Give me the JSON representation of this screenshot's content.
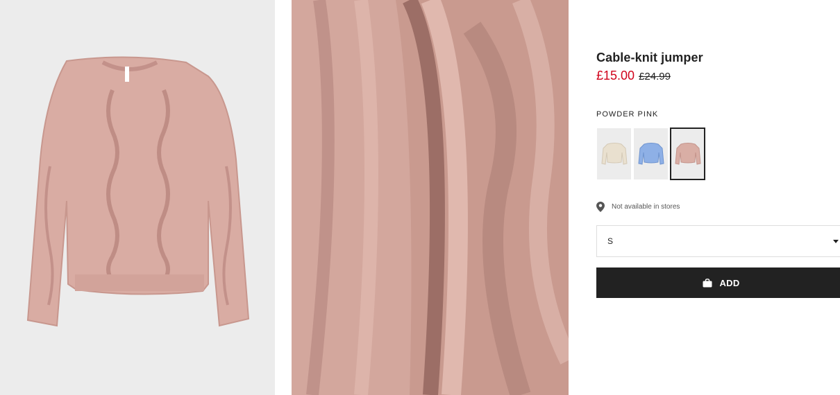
{
  "product": {
    "title": "Cable-knit jumper",
    "price_sale": "£15.00",
    "price_original": "£24.99"
  },
  "colors": {
    "selected_name": "POWDER PINK",
    "swatches": [
      {
        "icon": "sweater-beige-thumbnail",
        "hex": "#e9e0cf"
      },
      {
        "icon": "sweater-blue-thumbnail",
        "hex": "#8eb0e6"
      },
      {
        "icon": "sweater-pink-thumbnail",
        "hex": "#d9aea5"
      }
    ]
  },
  "store": {
    "icon": "location-pin-icon",
    "text": "Not available in stores"
  },
  "size_select": {
    "value": "S",
    "icon": "chevron-down-icon"
  },
  "add_button": {
    "label": "ADD",
    "icon": "shopping-bag-icon"
  },
  "images": [
    {
      "icon": "product-photo-sweater",
      "bg": "#ececec",
      "fill": "#d8aba2"
    },
    {
      "icon": "product-photo-knit-detail",
      "bg": "#c99a8f"
    }
  ]
}
